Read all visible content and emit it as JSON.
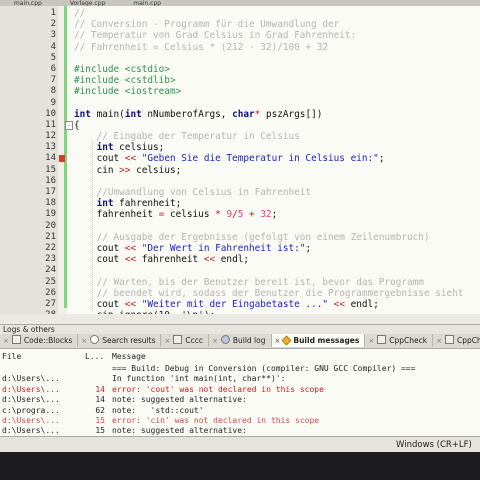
{
  "tabs": [
    "main.cpp",
    "Vorlage.cpp",
    "main.cpp"
  ],
  "editor": {
    "lines": [
      {
        "n": "1",
        "segs": [
          {
            "c": "cm",
            "t": "//"
          }
        ]
      },
      {
        "n": "2",
        "segs": [
          {
            "c": "cm",
            "t": "// Conversion - Programm für die Umwandlung der"
          }
        ]
      },
      {
        "n": "3",
        "segs": [
          {
            "c": "cm",
            "t": "// Temperatur von Grad Celsius in Grad Fahrenheit:"
          }
        ]
      },
      {
        "n": "4",
        "segs": [
          {
            "c": "cm",
            "t": "// Fahrenheit = Celsius * (212 - 32)/100 + 32"
          }
        ]
      },
      {
        "n": "5",
        "segs": []
      },
      {
        "n": "6",
        "segs": [
          {
            "c": "pp",
            "t": "#include <cstdio>"
          }
        ]
      },
      {
        "n": "7",
        "segs": [
          {
            "c": "pp",
            "t": "#include <cstdlib>"
          }
        ]
      },
      {
        "n": "8",
        "segs": [
          {
            "c": "pp",
            "t": "#include <iostream>"
          }
        ]
      },
      {
        "n": "9",
        "segs": []
      },
      {
        "n": "10",
        "segs": [
          {
            "c": "kw",
            "t": "int"
          },
          {
            "c": "plain",
            "t": " main("
          },
          {
            "c": "kw",
            "t": "int"
          },
          {
            "c": "plain",
            "t": " nNumberofArgs, "
          },
          {
            "c": "kw",
            "t": "char"
          },
          {
            "c": "op",
            "t": "*"
          },
          {
            "c": "plain",
            "t": " pszArgs[])"
          }
        ]
      },
      {
        "n": "11",
        "segs": [
          {
            "c": "plain",
            "t": "{"
          }
        ],
        "fold": true
      },
      {
        "n": "12",
        "segs": [
          {
            "c": "cm",
            "t": "    // Eingabe der Temperatur in Celsius"
          }
        ]
      },
      {
        "n": "13",
        "segs": [
          {
            "c": "kw",
            "t": "    int"
          },
          {
            "c": "plain",
            "t": " celsius;"
          }
        ]
      },
      {
        "n": "14",
        "segs": [
          {
            "c": "plain",
            "t": "    cout "
          },
          {
            "c": "op",
            "t": "<<"
          },
          {
            "c": "str",
            "t": " \"Geben Sie die Temperatur in Celsius ein:\""
          },
          {
            "c": "plain",
            "t": ";"
          }
        ],
        "marker": true
      },
      {
        "n": "15",
        "segs": [
          {
            "c": "plain",
            "t": "    cin "
          },
          {
            "c": "op",
            "t": ">>"
          },
          {
            "c": "plain",
            "t": " celsius;"
          }
        ]
      },
      {
        "n": "16",
        "segs": []
      },
      {
        "n": "17",
        "segs": [
          {
            "c": "cm",
            "t": "    //Umwandlung von Celsius in Fahrenheit"
          }
        ]
      },
      {
        "n": "18",
        "segs": [
          {
            "c": "kw",
            "t": "    int"
          },
          {
            "c": "plain",
            "t": " fahrenheit;"
          }
        ]
      },
      {
        "n": "19",
        "segs": [
          {
            "c": "plain",
            "t": "    fahrenheit "
          },
          {
            "c": "op",
            "t": "="
          },
          {
            "c": "plain",
            "t": " celsius "
          },
          {
            "c": "op",
            "t": "*"
          },
          {
            "c": "num",
            "t": " 9"
          },
          {
            "c": "op",
            "t": "/"
          },
          {
            "c": "num",
            "t": "5"
          },
          {
            "c": "op",
            "t": " +"
          },
          {
            "c": "num",
            "t": " 32"
          },
          {
            "c": "plain",
            "t": ";"
          }
        ]
      },
      {
        "n": "20",
        "segs": []
      },
      {
        "n": "21",
        "segs": [
          {
            "c": "cm",
            "t": "    // Ausgabe der Ergebnisse (gefolgt von einem Zeilenumbruch)"
          }
        ]
      },
      {
        "n": "22",
        "segs": [
          {
            "c": "plain",
            "t": "    cout "
          },
          {
            "c": "op",
            "t": "<<"
          },
          {
            "c": "str",
            "t": " \"Der Wert in Fahrenheit ist:\""
          },
          {
            "c": "plain",
            "t": ";"
          }
        ]
      },
      {
        "n": "23",
        "segs": [
          {
            "c": "plain",
            "t": "    cout "
          },
          {
            "c": "op",
            "t": "<<"
          },
          {
            "c": "plain",
            "t": " fahrenheit "
          },
          {
            "c": "op",
            "t": "<<"
          },
          {
            "c": "plain",
            "t": " endl;"
          }
        ]
      },
      {
        "n": "24",
        "segs": []
      },
      {
        "n": "25",
        "segs": [
          {
            "c": "cm",
            "t": "    // Warten, bis der Benutzer bereit ist, bevor das Programm"
          }
        ]
      },
      {
        "n": "26",
        "segs": [
          {
            "c": "cm",
            "t": "    // beendet wird, sodass der Benutzer die Programmergebnisse sieht"
          }
        ]
      },
      {
        "n": "27",
        "segs": [
          {
            "c": "plain",
            "t": "    cout "
          },
          {
            "c": "op",
            "t": "<<"
          },
          {
            "c": "str",
            "t": " \"Weiter mit der Eingabetaste ...\""
          },
          {
            "c": "plain",
            "t": " "
          },
          {
            "c": "op",
            "t": "<<"
          },
          {
            "c": "plain",
            "t": " endl;"
          }
        ]
      },
      {
        "n": "28",
        "segs": [
          {
            "c": "plain",
            "t": "    cin.ignore(10, '\\n');"
          }
        ]
      }
    ]
  },
  "logs": {
    "title": "Logs & others",
    "tabs": [
      {
        "label": "Code::Blocks",
        "icon": "codeblocks-icon",
        "active": false
      },
      {
        "label": "Search results",
        "icon": "search-icon",
        "active": false
      },
      {
        "label": "Cccc",
        "icon": "cccc-icon",
        "active": false
      },
      {
        "label": "Build log",
        "icon": "gear-icon",
        "active": false
      },
      {
        "label": "Build messages",
        "icon": "warning-icon",
        "active": true
      },
      {
        "label": "CppCheck",
        "icon": "cppcheck-icon",
        "active": false
      },
      {
        "label": "CppChe",
        "icon": "cppcheck-icon",
        "active": false
      }
    ],
    "headers": {
      "file": "File",
      "line": "L...",
      "message": "Message"
    },
    "rows": [
      {
        "file": "",
        "line": "",
        "msg": "=== Build: Debug in Conversion (compiler: GNU GCC Compiler) ===",
        "kind": "info"
      },
      {
        "file": "d:\\Users\\...",
        "line": "",
        "msg": "In function 'int main(int, char**)':",
        "kind": "info"
      },
      {
        "file": "d:\\Users\\...",
        "line": "14",
        "msg": "error: 'cout' was not declared in this scope",
        "kind": "err"
      },
      {
        "file": "d:\\Users\\...",
        "line": "14",
        "msg": "note: suggested alternative:",
        "kind": "info"
      },
      {
        "file": "c:\\progra...",
        "line": "62",
        "msg": "note:   'std::cout'",
        "kind": "info"
      },
      {
        "file": "d:\\Users\\...",
        "line": "15",
        "msg": "error: 'cin' was not declared in this scope",
        "kind": "err2"
      },
      {
        "file": "d:\\Users\\...",
        "line": "15",
        "msg": "note: suggested alternative:",
        "kind": "info"
      }
    ]
  },
  "status": {
    "encoding": "Windows (CR+LF)  WIN"
  }
}
